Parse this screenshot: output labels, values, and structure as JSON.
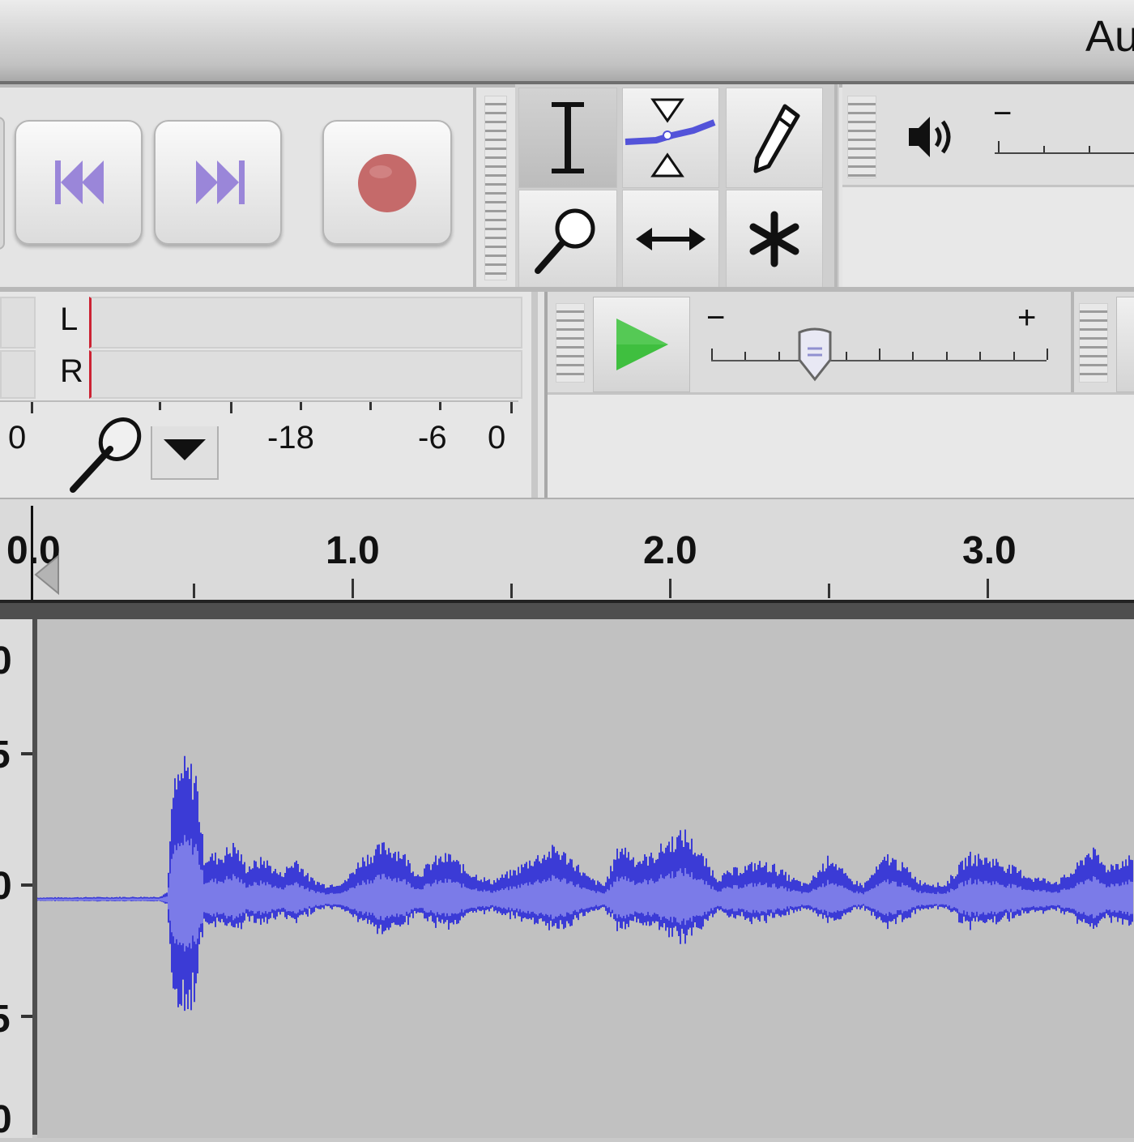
{
  "window": {
    "title_fragment": "Au"
  },
  "transport": {
    "skip_start_icon": "skip-to-start-icon",
    "skip_end_icon": "skip-to-end-icon",
    "record_icon": "record-icon",
    "record_color": "#c56a6a",
    "skip_color": "#9a86d9"
  },
  "tools": [
    "selection-tool",
    "envelope-tool",
    "draw-tool",
    "zoom-tool",
    "timeshift-tool",
    "multi-tool"
  ],
  "output": {
    "minus": "−"
  },
  "input_meter": {
    "channel_left": "L",
    "channel_right": "R",
    "scale": [
      "0",
      "-18",
      "-6",
      "0"
    ]
  },
  "play_speed": {
    "minus": "−",
    "plus": "+",
    "level": 0.31
  },
  "ruler": {
    "labels": [
      "0.0",
      "1.0",
      "2.0",
      "3.0"
    ]
  },
  "colors": {
    "waveform": "#3b3bd6",
    "waveform_rms": "#7b7be8",
    "play_green": "#3fbf3f"
  }
}
